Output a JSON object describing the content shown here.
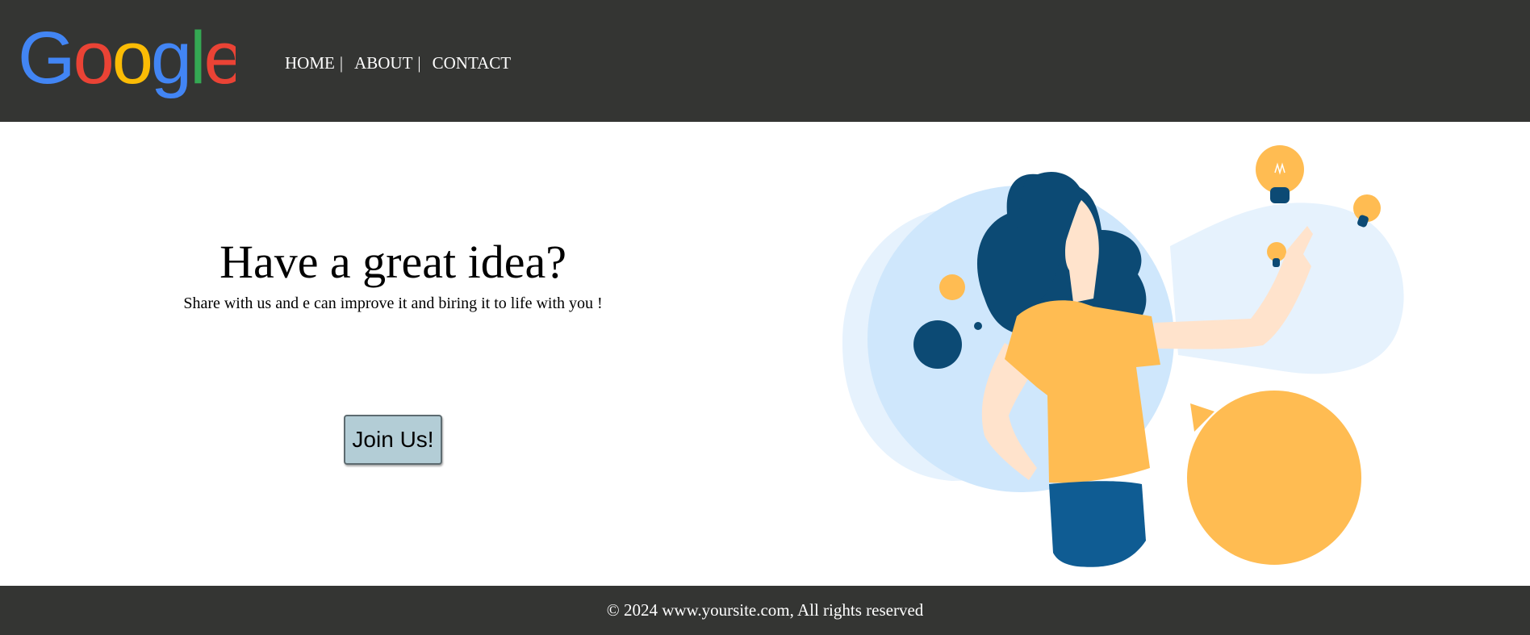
{
  "header": {
    "logo_text": "Google",
    "nav": [
      {
        "label": "HOME"
      },
      {
        "label": "ABOUT"
      },
      {
        "label": "CONTACT"
      }
    ],
    "separator": "|"
  },
  "hero": {
    "title": "Have a great idea?",
    "subtitle": "Share with us and e can improve it and biring it to life with you !",
    "button_label": "Join Us!"
  },
  "footer": {
    "text": "© 2024 www.yoursite.com, All rights reserved"
  },
  "colors": {
    "header_bg": "#343533",
    "button_bg": "#b3cdd6",
    "google_blue": "#4285F4",
    "google_red": "#EA4335",
    "google_yellow": "#FBBC05",
    "google_green": "#34A853",
    "illustration_yellow": "#FFBC52",
    "illustration_navy": "#0C4A74"
  }
}
